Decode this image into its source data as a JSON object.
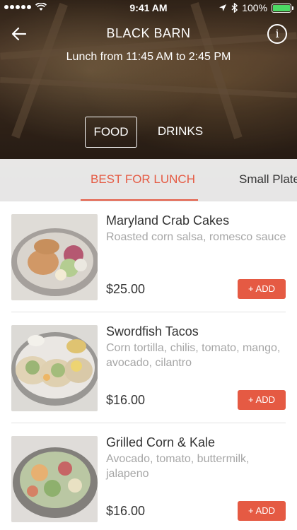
{
  "status_bar": {
    "time": "9:41 AM",
    "battery": "100%",
    "battery_level": 1.0,
    "icons": [
      "signal-dots-icon",
      "wifi-icon",
      "location-arrow-icon",
      "bluetooth-icon",
      "battery-icon"
    ]
  },
  "header": {
    "title": "BLACK BARN",
    "hours": "Lunch from 11:45 AM to 2:45 PM",
    "back_icon": "back-arrow-icon",
    "info_icon": "info-icon",
    "info_glyph": "i"
  },
  "menu_tabs": [
    {
      "label": "FOOD",
      "active": true
    },
    {
      "label": "DRINKS",
      "active": false
    }
  ],
  "categories": [
    {
      "label": "BEST FOR LUNCH",
      "active": true
    },
    {
      "label": "Small Plates",
      "active": false
    }
  ],
  "items": [
    {
      "name": "Maryland Crab Cakes",
      "description": "Roasted corn salsa, romesco sauce",
      "price": "$25.00",
      "add_label": "+ ADD"
    },
    {
      "name": "Swordfish Tacos",
      "description": "Corn tortilla, chilis, tomato, mango, avocado, cilantro",
      "price": "$16.00",
      "add_label": "+ ADD"
    },
    {
      "name": "Grilled Corn & Kale",
      "description": "Avocado, tomato, buttermilk, jalapeno",
      "price": "$16.00",
      "add_label": "+ ADD"
    }
  ],
  "colors": {
    "accent": "#e55a43",
    "battery": "#4cd964",
    "muted_text": "#a6a6a6"
  }
}
